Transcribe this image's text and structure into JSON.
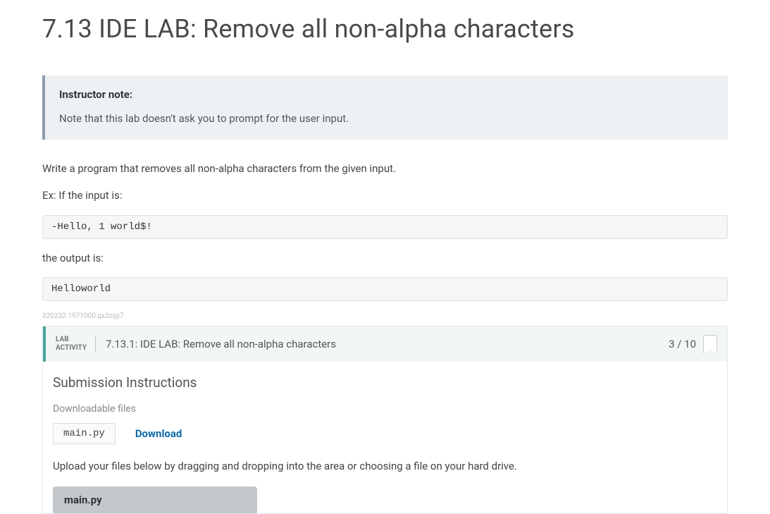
{
  "page_title": "7.13 IDE LAB: Remove all non-alpha characters",
  "instructor_note": {
    "title": "Instructor note:",
    "body": "Note that this lab doesn't ask you to prompt for the user input."
  },
  "instructions": {
    "line1": "Write a program that removes all non-alpha characters from the given input.",
    "line2": "Ex: If the input is:",
    "example_input": "-Hello, 1 world$!",
    "line3": "the output is:",
    "example_output": "Helloworld"
  },
  "resource_id": "320232.1971000.qx3zqy7",
  "lab": {
    "activity_label_1": "LAB",
    "activity_label_2": "ACTIVITY",
    "title": "7.13.1: IDE LAB: Remove all non-alpha characters",
    "score": "3 / 10"
  },
  "submission": {
    "heading": "Submission Instructions",
    "downloadable_label": "Downloadable files",
    "file_name": "main.py",
    "download_label": "Download",
    "upload_instruction": "Upload your files below by dragging and dropping into the area or choosing a file on your hard drive.",
    "upload_tab_label": "main.py"
  }
}
